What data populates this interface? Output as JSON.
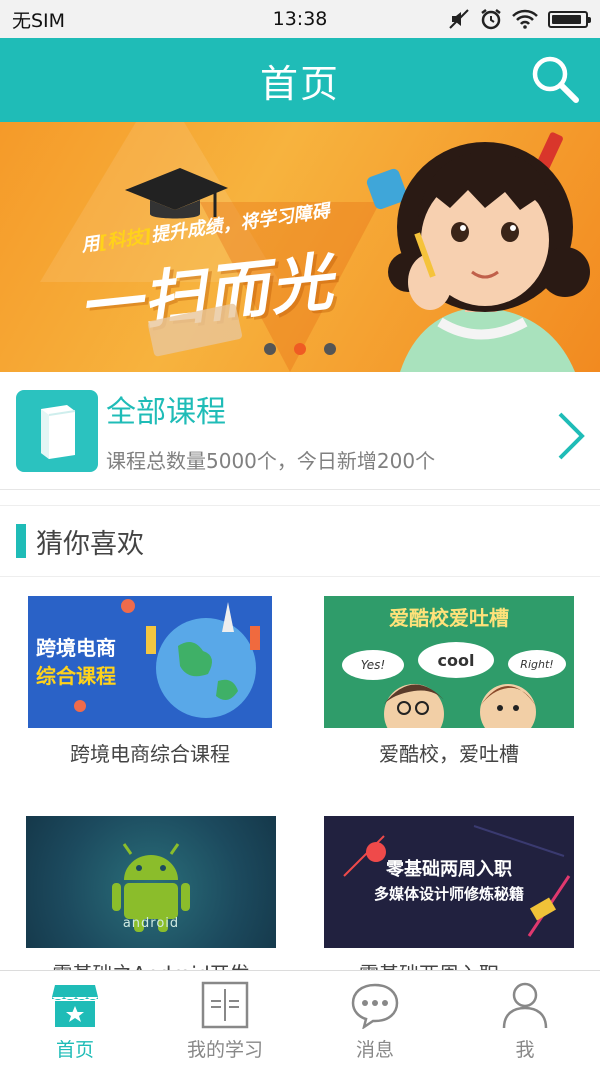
{
  "status_bar": {
    "carrier": "无SIM",
    "time": "13:38",
    "battery_level": 0.9,
    "icons": [
      "mute-icon",
      "alarm-icon",
      "wifi-icon",
      "battery-icon"
    ]
  },
  "header": {
    "title": "首页",
    "search_icon": "search-icon"
  },
  "banner": {
    "slogan_prefix": "用",
    "slogan_highlight": "[科技]",
    "slogan_rest": "提升成绩，将学习障碍",
    "slogan_big": "一扫而光",
    "page_count": 3,
    "active_page": 2
  },
  "all_courses": {
    "title": "全部课程",
    "subtitle": "课程总数量5000个，今日新增200个"
  },
  "section": {
    "title": "猜你喜欢"
  },
  "courses": [
    {
      "thumb_line1": "跨境电商",
      "thumb_line2": "综合课程",
      "caption": "跨境电商综合课程"
    },
    {
      "thumb_title": "爱酷校爱吐槽",
      "bubble1": "Yes!",
      "bubble2": "cool",
      "bubble3": "Right!",
      "caption": "爱酷校，爱吐槽"
    },
    {
      "thumb_text": "android",
      "caption": "零基础之Android开发"
    },
    {
      "thumb_line1": "零基础两周入职",
      "thumb_line2": "多媒体设计师修炼秘籍",
      "caption": "零基础两周入职——"
    }
  ],
  "nav": [
    {
      "label": "首页",
      "icon": "home-store-icon",
      "active": true
    },
    {
      "label": "我的学习",
      "icon": "book-icon",
      "active": false
    },
    {
      "label": "消息",
      "icon": "message-icon",
      "active": false
    },
    {
      "label": "我",
      "icon": "user-icon",
      "active": false
    }
  ],
  "colors": {
    "accent": "#1fbcb7",
    "banner_orange": "#f59a29",
    "dot_active": "#ef5b23"
  }
}
